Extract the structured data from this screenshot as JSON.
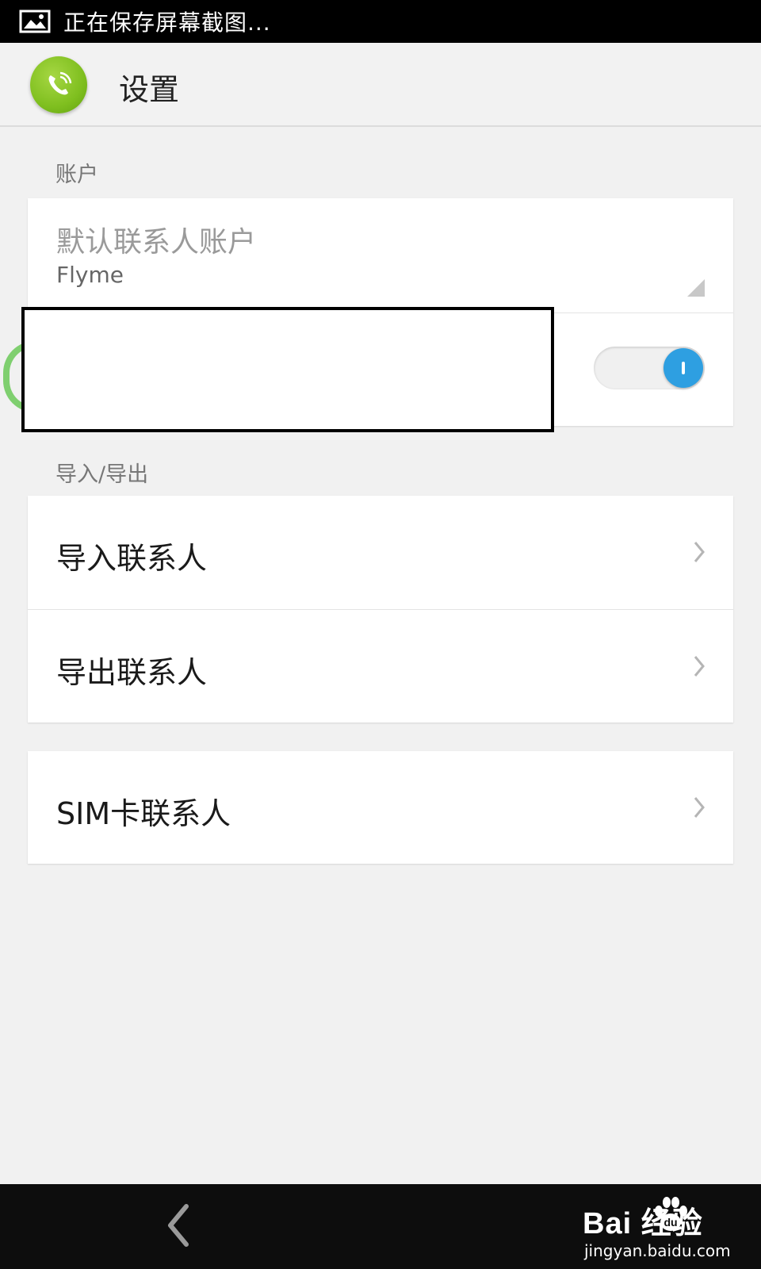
{
  "status_bar": {
    "text": "正在保存屏幕截图..."
  },
  "header": {
    "title": "设置"
  },
  "sections": {
    "account": {
      "title": "账户",
      "default_account": {
        "title": "默认联系人账户",
        "value": "Flyme"
      },
      "toggle": {
        "state": "on"
      }
    },
    "import_export": {
      "title": "导入/导出",
      "items": [
        {
          "label": "导入联系人"
        },
        {
          "label": "导出联系人"
        }
      ]
    },
    "sim": {
      "label": "SIM卡联系人"
    }
  },
  "watermark": {
    "logo_text": "Bai  经验",
    "url": "jingyan.baidu.com"
  },
  "colors": {
    "accent": "#2e9fe1",
    "app_icon": "#7fbf1f"
  }
}
